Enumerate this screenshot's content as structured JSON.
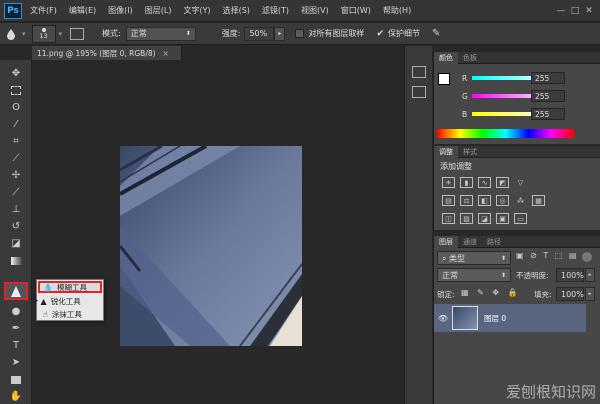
{
  "app": {
    "logo": "Ps"
  },
  "menu": [
    "文件(F)",
    "编辑(E)",
    "图像(I)",
    "图层(L)",
    "文字(Y)",
    "选择(S)",
    "滤镜(T)",
    "视图(V)",
    "窗口(W)",
    "帮助(H)"
  ],
  "window_controls": [
    "—",
    "□",
    "✕"
  ],
  "options": {
    "brush_size": "13",
    "mode_label": "模式:",
    "mode_value": "正常",
    "strength_label": "强度:",
    "strength_value": "50%",
    "sample_all_label": "对所有图层取样",
    "protect_detail_label": "保护细节",
    "protect_detail_checked": "✔"
  },
  "document": {
    "tab_title": "11.png @ 195% (图层 0, RGB/8)",
    "close": "×"
  },
  "tool_flyout": {
    "items": [
      {
        "label": "模糊工具",
        "icon": "blur-drop-icon",
        "selected": true
      },
      {
        "label": "锐化工具",
        "icon": "sharpen-triangle-icon",
        "selected": false
      },
      {
        "label": "涂抹工具",
        "icon": "smudge-finger-icon",
        "selected": false
      }
    ]
  },
  "color_panel": {
    "tabs": [
      "颜色",
      "色板"
    ],
    "channels": [
      {
        "label": "R",
        "value": "255"
      },
      {
        "label": "G",
        "value": "255"
      },
      {
        "label": "B",
        "value": "255"
      }
    ]
  },
  "adjustments_panel": {
    "tabs": [
      "调整",
      "样式"
    ],
    "title": "添加调整"
  },
  "layers_panel": {
    "tabs": [
      "图层",
      "通道",
      "路径"
    ],
    "filter_type": "类型",
    "blend_mode": "正常",
    "opacity_label": "不透明度:",
    "opacity_value": "100%",
    "lock_label": "锁定:",
    "fill_label": "填充:",
    "fill_value": "100%",
    "layer": {
      "name": "图层 0",
      "visible_icon": "eye-icon"
    }
  },
  "watermark": "爱刨根知识网",
  "colors": {
    "accent_red": "#e0242a",
    "selected_layer": "#5a6580"
  }
}
